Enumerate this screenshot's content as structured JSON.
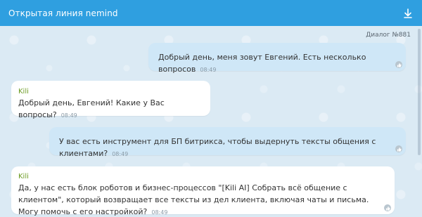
{
  "header": {
    "title": "Открытая линия nemind",
    "download_icon": "download-icon"
  },
  "chat": {
    "dialog_label": "Диалог №881",
    "messages": [
      {
        "direction": "out",
        "text": "Добрый день, меня зовут Евгений. Есть несколько вопросов",
        "time": "08:49"
      },
      {
        "direction": "in",
        "sender": "Kili",
        "text": "Добрый день, Евгений! Какие у Вас вопросы?",
        "time": "08:49"
      },
      {
        "direction": "out",
        "text": "У вас есть инструмент для БП битрикса, чтобы выдернуть тексты общения с клиентами?",
        "time": "08:49"
      },
      {
        "direction": "in",
        "sender": "Kili",
        "text": "Да, у нас есть блок роботов и бизнес-процессов \"[Kili AI] Собрать всё общение с клиентом\", который возвращает все тексты из дел клиента, включая чаты и письма. Могу помочь с его настройкой?",
        "time": "08:49"
      }
    ],
    "like_icon": "like-icon"
  },
  "colors": {
    "header": "#2f9fe0",
    "outgoing_bubble": "#cfe7f7",
    "incoming_bubble": "#ffffff",
    "sender_name": "#6a9a1f"
  }
}
